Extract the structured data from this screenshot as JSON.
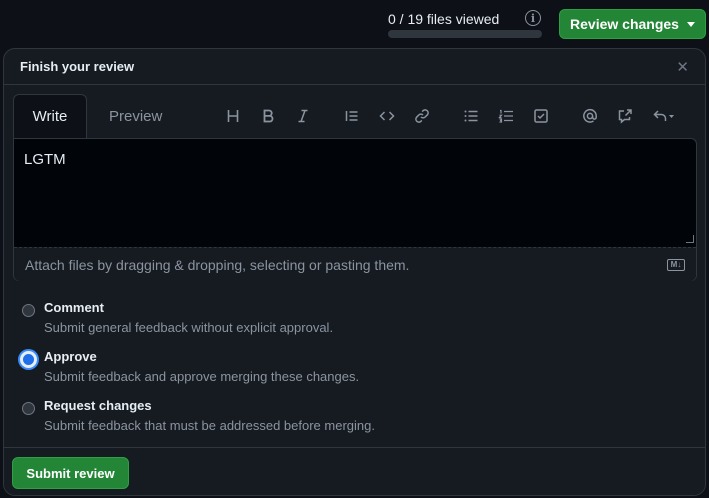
{
  "header": {
    "files_viewed": "0 / 19 files viewed",
    "files_viewed_progress": 0,
    "review_button_label": "Review changes"
  },
  "dialog": {
    "title": "Finish your review",
    "tabs": {
      "write": "Write",
      "preview": "Preview"
    },
    "toolbar_icons": [
      "heading-icon",
      "bold-icon",
      "italic-icon",
      "quote-icon",
      "code-icon",
      "link-icon",
      "unordered-list-icon",
      "ordered-list-icon",
      "task-list-icon",
      "mention-icon",
      "reference-icon",
      "undo-icon"
    ],
    "comment_value": "LGTM",
    "attach_text": "Attach files by dragging & dropping, selecting or pasting them.",
    "options": [
      {
        "title": "Comment",
        "desc": "Submit general feedback without explicit approval.",
        "checked": false
      },
      {
        "title": "Approve",
        "desc": "Submit feedback and approve merging these changes.",
        "checked": true
      },
      {
        "title": "Request changes",
        "desc": "Submit feedback that must be addressed before merging.",
        "checked": false
      }
    ],
    "submit_label": "Submit review"
  },
  "colors": {
    "background": "#0d1117",
    "panel": "#161b22",
    "primary_green": "#238636",
    "accent_blue": "#1f6feb",
    "muted_text": "#8b949e"
  }
}
